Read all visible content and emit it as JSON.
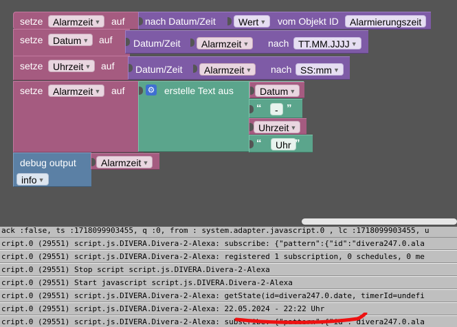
{
  "workspace": {
    "block1": {
      "kw_set": "setze",
      "var": "Alarmzeit",
      "kw_to": "auf",
      "fn": "nach Datum/Zeit",
      "value_dd": "Wert",
      "obj_label": "vom Objekt ID",
      "obj_id": "Alarmierungszeit"
    },
    "block2": {
      "kw_set": "setze",
      "var": "Datum",
      "kw_to": "auf",
      "fn": "Datum/Zeit",
      "var_in": "Alarmzeit",
      "kw_nach": "nach",
      "format": "TT.MM.JJJJ"
    },
    "block3": {
      "kw_set": "setze",
      "var": "Uhrzeit",
      "kw_to": "auf",
      "fn": "Datum/Zeit",
      "var_in": "Alarmzeit",
      "kw_nach": "nach",
      "format": "SS:mm"
    },
    "block4": {
      "kw_set": "setze",
      "var": "Alarmzeit",
      "kw_to": "auf",
      "fn": "erstelle Text aus",
      "item1": "Datum",
      "item2": "-",
      "item3": "Uhrzeit",
      "item4": "Uhr",
      "quote_open": "“",
      "quote_close": "”"
    },
    "block5": {
      "label": "debug output",
      "var": "Alarmzeit",
      "level": "info"
    }
  },
  "console": {
    "lines": [
      "ack :false, ts :1718099903455, q :0, from : system.adapter.javascript.0 , lc :1718099903455, u",
      "cript.0 (29551) script.js.DIVERA.Divera-2-Alexa: subscribe: {\"pattern\":{\"id\":\"divera247.0.ala",
      "cript.0 (29551) script.js.DIVERA.Divera-2-Alexa: registered 1 subscription, 0 schedules, 0 me",
      "cript.0 (29551) Stop script script.js.DIVERA.Divera-2-Alexa",
      "cript.0 (29551) Start javascript script.js.DIVERA.Divera-2-Alexa",
      "cript.0 (29551) script.js.DIVERA.Divera-2-Alexa: getState(id=divera247.0.date, timerId=undefi",
      "cript.0 (29551) script.js.DIVERA.Divera-2-Alexa: 22.05.2024 - 22:22 Uhr",
      "cript.0 (29551) script.js.DIVERA.Divera-2-Alexa: subscribe: {\"pattern\":{\"id\":\"divera247.0.ala"
    ]
  },
  "colors": {
    "var_block": "#a55b80",
    "time_block": "#7e5ba6",
    "text_block": "#5ba58c",
    "debug_block": "#5b80a5",
    "highlight": "#ee1111"
  }
}
